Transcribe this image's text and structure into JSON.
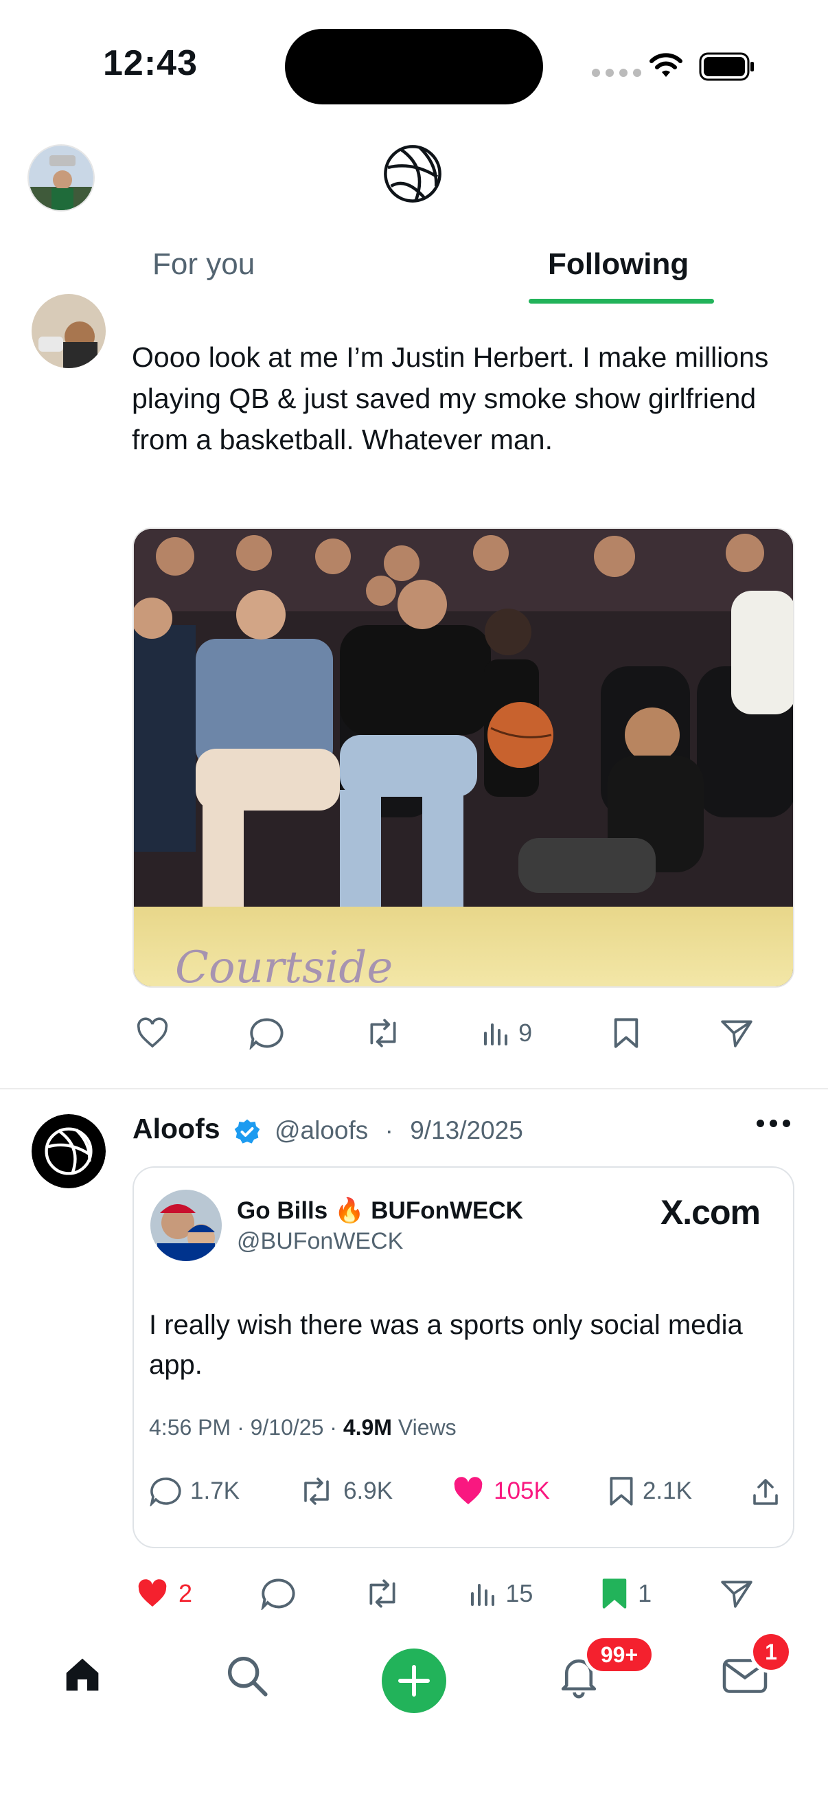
{
  "status_bar": {
    "time": "12:43"
  },
  "header": {
    "tabs": [
      {
        "label": "For you"
      },
      {
        "label": "Following"
      }
    ]
  },
  "post1": {
    "text": "Oooo look at me I’m Justin Herbert. I make millions playing QB & just saved my smoke show girlfriend from a basketball. Whatever man.",
    "court_text": "Courtside",
    "views": "9"
  },
  "post2": {
    "author": "Aloofs",
    "handle": "@aloofs",
    "separator": "·",
    "date": "9/13/2025",
    "embed": {
      "name": "Go Bills 🔥 BUFonWECK",
      "handle": "@BUFonWECK",
      "source": "X.com",
      "text": "I really wish there was a sports only social media app.",
      "meta_time": "4:56 PM · 9/10/25 · ",
      "meta_views_count": "4.9M",
      "meta_views_label": " Views",
      "replies": "1.7K",
      "reposts": "6.9K",
      "likes": "105K",
      "bookmarks": "2.1K"
    },
    "likes": "2",
    "views": "15",
    "bookmarks": "1"
  },
  "tabbar": {
    "notifications_badge": "99+",
    "messages_badge": "1"
  },
  "colors": {
    "accent_green": "#22b35a",
    "like_red": "#f4212e",
    "like_pink": "#f91880",
    "verified_blue": "#1d9bf0",
    "text": "#0f1419",
    "muted": "#536471"
  }
}
